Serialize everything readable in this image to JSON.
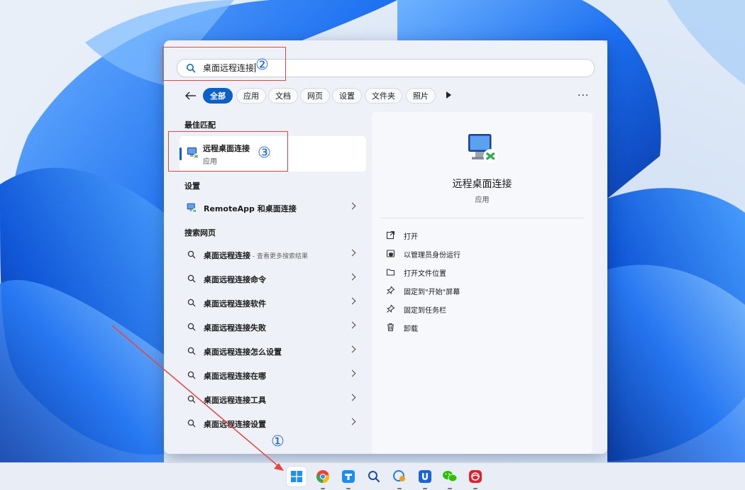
{
  "search": {
    "query": "桌面远程连接"
  },
  "filters": {
    "chips": [
      "全部",
      "应用",
      "文档",
      "网页",
      "设置",
      "文件夹",
      "照片"
    ],
    "more": "..."
  },
  "best_match": {
    "header": "最佳匹配",
    "title": "远程桌面连接",
    "subtitle": "应用"
  },
  "settings_section": {
    "header": "设置",
    "item": "RemoteApp 和桌面连接"
  },
  "web_section": {
    "header": "搜索网页",
    "first_item": "桌面远程连接",
    "first_item_suffix": " - 查看更多搜索结果",
    "items": [
      "桌面远程连接命令",
      "桌面远程连接软件",
      "桌面远程连接失败",
      "桌面远程连接怎么设置",
      "桌面远程连接在哪",
      "桌面远程连接工具",
      "桌面远程连接设置"
    ]
  },
  "detail": {
    "title": "远程桌面连接",
    "subtitle": "应用",
    "actions": [
      {
        "label": "打开",
        "icon": "open-external-icon"
      },
      {
        "label": "以管理员身份运行",
        "icon": "shield-admin-icon"
      },
      {
        "label": "打开文件位置",
        "icon": "folder-icon"
      },
      {
        "label": "固定到\"开始\"屏幕",
        "icon": "pin-icon"
      },
      {
        "label": "固定到任务栏",
        "icon": "pin-icon"
      },
      {
        "label": "卸载",
        "icon": "trash-icon"
      }
    ]
  },
  "annotations": [
    "①",
    "②",
    "③"
  ],
  "taskbar": {
    "icons": [
      "windows-start-icon",
      "chrome-icon",
      "app-icon",
      "search-icon",
      "chat-icon",
      "shield-app-icon",
      "wechat-icon",
      "netease-music-icon"
    ]
  },
  "colors": {
    "accent": "#0b5fc7",
    "annotation_red": "#e8453c",
    "annotation_blue": "#1a62d6"
  }
}
